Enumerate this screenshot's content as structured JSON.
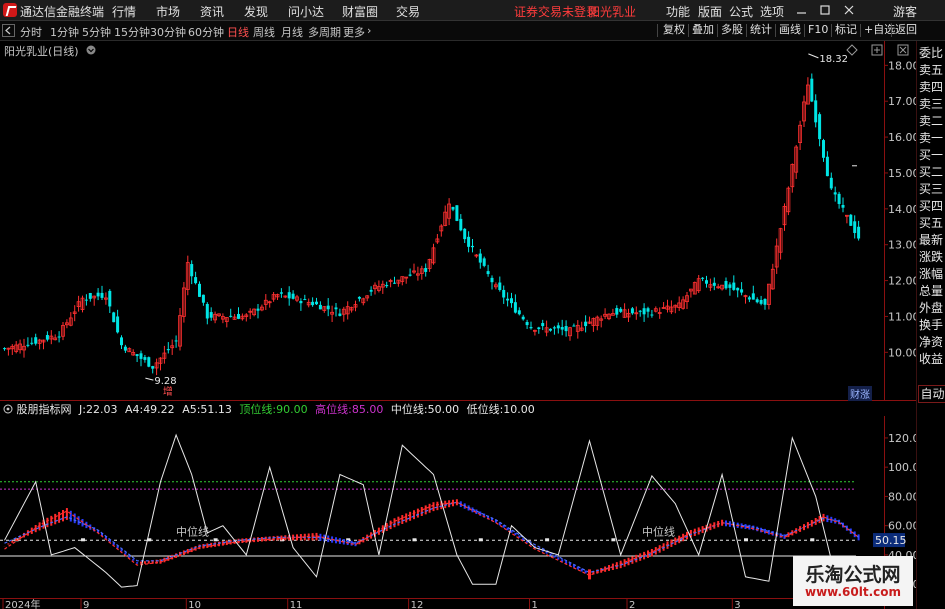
{
  "app": {
    "title": "通达信金融终端",
    "menu": [
      "行情",
      "市场",
      "资讯",
      "发现",
      "问小达",
      "财富圈",
      "交易"
    ],
    "notice": "证券交易未登录",
    "stock_name": "阳光乳业",
    "right_menu": [
      "功能",
      "版面",
      "公式",
      "选项"
    ],
    "guest": "游客"
  },
  "toolbar": {
    "periods": [
      "分时",
      "1分钟",
      "5分钟",
      "15分钟",
      "30分钟",
      "60分钟",
      "日线",
      "周线",
      "月线",
      "多周期",
      "更多"
    ],
    "active_period": "日线",
    "more_chevron": "›",
    "right_buttons": [
      "复权",
      "叠加",
      "多股",
      "统计",
      "画线",
      "F10",
      "标记",
      "+自选",
      "返回"
    ]
  },
  "sidebar": {
    "items": [
      "委比",
      "卖五",
      "卖四",
      "卖三",
      "卖二",
      "卖一",
      "买一",
      "买二",
      "买三",
      "买四",
      "买五",
      "最新",
      "涨跌",
      "涨幅",
      "总量",
      "外盘",
      "换手",
      "净资",
      "收益"
    ],
    "auto": "自动"
  },
  "main_chart": {
    "label": "阳光乳业(日线)",
    "high_annotation": "18.32",
    "low_annotation": "9.28",
    "marker": "增",
    "tag": "财涨",
    "icons": [
      "settings-diamond-icon",
      "zoom-icon",
      "close-icon"
    ],
    "colors": {
      "up": "#ff3030",
      "down": "#00e4e4"
    }
  },
  "indicator": {
    "name": "股朋指标网",
    "items": [
      {
        "label": "J:",
        "value": "22.03",
        "color": "#e8e8e8"
      },
      {
        "label": "A4:",
        "value": "49.22",
        "color": "#e8e8e8"
      },
      {
        "label": "A5:",
        "value": "51.13",
        "color": "#e8e8e8"
      },
      {
        "label": "顶位线:",
        "value": "90.00",
        "color": "#33cc33"
      },
      {
        "label": "高位线:",
        "value": "85.00",
        "color": "#cc33cc"
      },
      {
        "label": "中位线:",
        "value": "50.00",
        "color": "#e8e8e8"
      },
      {
        "label": "低位线:",
        "value": "10.00",
        "color": "#e8e8e8"
      }
    ],
    "mid_line_text": "中位线",
    "current_value": "50.15"
  },
  "chart_data": [
    {
      "type": "candlestick",
      "title": "阳光乳业(日线)",
      "y_ticks": [
        10.0,
        11.0,
        12.0,
        13.0,
        14.0,
        15.0,
        16.0,
        17.0,
        18.0
      ],
      "ylim": [
        9.2,
        18.4
      ],
      "x_labels": [
        "2024年",
        "9",
        "10",
        "11",
        "12",
        "1",
        "2",
        "3"
      ],
      "annotations": {
        "high": 18.32,
        "low": 9.28
      },
      "keypoints": [
        {
          "i": 0,
          "c": 10.1
        },
        {
          "i": 8,
          "c": 10.3
        },
        {
          "i": 14,
          "c": 10.5
        },
        {
          "i": 20,
          "c": 11.5
        },
        {
          "i": 26,
          "c": 11.6
        },
        {
          "i": 30,
          "c": 10.2
        },
        {
          "i": 38,
          "c": 9.6
        },
        {
          "i": 44,
          "c": 10.3
        },
        {
          "i": 47,
          "c": 12.5
        },
        {
          "i": 52,
          "c": 11.0
        },
        {
          "i": 62,
          "c": 11.0
        },
        {
          "i": 70,
          "c": 11.6
        },
        {
          "i": 78,
          "c": 11.4
        },
        {
          "i": 86,
          "c": 11.1
        },
        {
          "i": 95,
          "c": 11.8
        },
        {
          "i": 108,
          "c": 12.3
        },
        {
          "i": 114,
          "c": 14.2
        },
        {
          "i": 118,
          "c": 13.2
        },
        {
          "i": 126,
          "c": 11.8
        },
        {
          "i": 135,
          "c": 10.7
        },
        {
          "i": 145,
          "c": 10.6
        },
        {
          "i": 155,
          "c": 11.1
        },
        {
          "i": 165,
          "c": 11.1
        },
        {
          "i": 173,
          "c": 11.3
        },
        {
          "i": 178,
          "c": 12.0
        },
        {
          "i": 186,
          "c": 11.8
        },
        {
          "i": 195,
          "c": 11.3
        },
        {
          "i": 200,
          "c": 14.0
        },
        {
          "i": 206,
          "c": 17.5
        },
        {
          "i": 212,
          "c": 14.5
        },
        {
          "i": 219,
          "c": 13.2
        }
      ]
    },
    {
      "type": "line",
      "title": "股朋指标网",
      "y_ticks": [
        20.0,
        40.0,
        60.0,
        80.0,
        100.0,
        120.0
      ],
      "ylim": [
        16,
        135
      ],
      "reference_lines": [
        {
          "name": "顶位线",
          "value": 90,
          "color": "#33cc33"
        },
        {
          "name": "高位线",
          "value": 85,
          "color": "#cc33cc"
        },
        {
          "name": "中位线",
          "value": 50,
          "color": "#e8e8e8"
        },
        {
          "name": "低位线",
          "value": 10,
          "color": "#e8e8e8"
        }
      ],
      "series": [
        {
          "name": "J",
          "color": "#e8e8e8",
          "keypoints": [
            [
              0,
              50
            ],
            [
              8,
              90
            ],
            [
              12,
              40
            ],
            [
              18,
              45
            ],
            [
              26,
              28
            ],
            [
              30,
              18
            ],
            [
              34,
              19
            ],
            [
              40,
              90
            ],
            [
              44,
              122
            ],
            [
              48,
              95
            ],
            [
              52,
              55
            ],
            [
              56,
              60
            ],
            [
              62,
              40
            ],
            [
              68,
              100
            ],
            [
              74,
              45
            ],
            [
              80,
              25
            ],
            [
              86,
              95
            ],
            [
              92,
              88
            ],
            [
              96,
              40
            ],
            [
              102,
              115
            ],
            [
              110,
              95
            ],
            [
              116,
              40
            ],
            [
              120,
              20
            ],
            [
              126,
              20
            ],
            [
              130,
              60
            ],
            [
              136,
              45
            ],
            [
              142,
              40
            ],
            [
              150,
              118
            ],
            [
              158,
              40
            ],
            [
              166,
              94
            ],
            [
              172,
              75
            ],
            [
              178,
              40
            ],
            [
              184,
              95
            ],
            [
              190,
              25
            ],
            [
              196,
              22
            ],
            [
              202,
              120
            ],
            [
              208,
              80
            ],
            [
              214,
              15
            ],
            [
              219,
              15
            ]
          ]
        },
        {
          "name": "A4",
          "color": "#ff3030",
          "keypoints": [
            [
              0,
              44
            ],
            [
              10,
              62
            ],
            [
              16,
              70
            ],
            [
              24,
              55
            ],
            [
              34,
              33
            ],
            [
              40,
              35
            ],
            [
              50,
              45
            ],
            [
              60,
              49
            ],
            [
              70,
              51
            ],
            [
              80,
              53
            ],
            [
              90,
              47
            ],
            [
              100,
              63
            ],
            [
              110,
              74
            ],
            [
              116,
              76
            ],
            [
              126,
              62
            ],
            [
              136,
              44
            ],
            [
              150,
              26
            ],
            [
              158,
              34
            ],
            [
              166,
              42
            ],
            [
              176,
              55
            ],
            [
              184,
              62
            ],
            [
              192,
              58
            ],
            [
              200,
              52
            ],
            [
              210,
              66
            ],
            [
              214,
              62
            ],
            [
              219,
              52
            ]
          ]
        },
        {
          "name": "A5",
          "color": "#4a6cff",
          "keypoints": [
            [
              0,
              48
            ],
            [
              10,
              60
            ],
            [
              16,
              66
            ],
            [
              24,
              57
            ],
            [
              34,
              36
            ],
            [
              40,
              36
            ],
            [
              50,
              46
            ],
            [
              60,
              50
            ],
            [
              70,
              52
            ],
            [
              80,
              52
            ],
            [
              90,
              48
            ],
            [
              100,
              61
            ],
            [
              110,
              72
            ],
            [
              116,
              76
            ],
            [
              126,
              64
            ],
            [
              136,
              47
            ],
            [
              150,
              28
            ],
            [
              158,
              33
            ],
            [
              166,
              41
            ],
            [
              176,
              54
            ],
            [
              184,
              62
            ],
            [
              192,
              59
            ],
            [
              200,
              53
            ],
            [
              210,
              65
            ],
            [
              214,
              63
            ],
            [
              219,
              52
            ]
          ]
        }
      ]
    }
  ]
}
